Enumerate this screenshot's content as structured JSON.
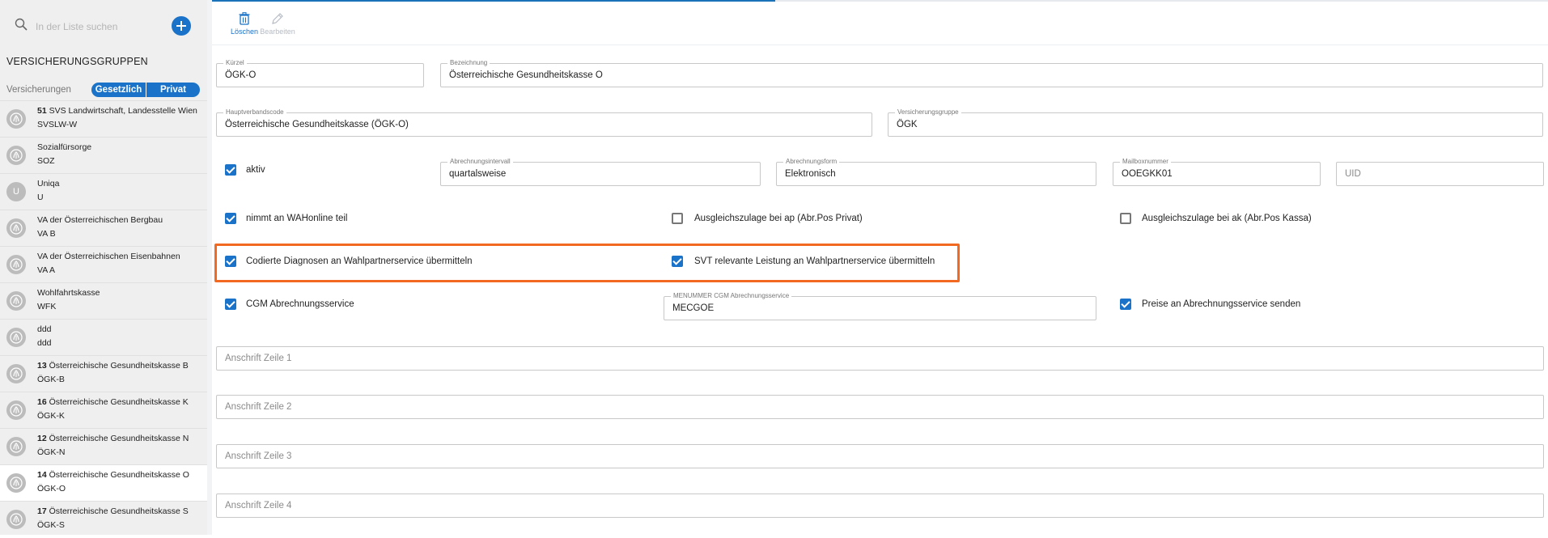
{
  "search": {
    "placeholder": "In der Liste suchen"
  },
  "sidebar": {
    "title": "VERSICHERUNGSGRUPPEN",
    "filter_label": "Versicherungen",
    "segments": [
      "Gesetzlich",
      "Privat"
    ],
    "items": [
      {
        "number": "51",
        "name": "SVS Landwirtschaft, Landesstelle Wien",
        "code": "SVSLW-W",
        "avatar": "logo-icon",
        "selected": false
      },
      {
        "number": "",
        "name": "Sozialfürsorge",
        "code": "SOZ",
        "avatar": "logo-icon",
        "selected": false
      },
      {
        "number": "",
        "name": "Uniqa",
        "code": "U",
        "avatar_letter": "U",
        "selected": false
      },
      {
        "number": "",
        "name": "VA der Österreichischen Bergbau",
        "code": "VA B",
        "avatar": "logo-icon",
        "selected": false
      },
      {
        "number": "",
        "name": "VA der Österreichischen Eisenbahnen",
        "code": "VA A",
        "avatar": "logo-icon",
        "selected": false
      },
      {
        "number": "",
        "name": "Wohlfahrtskasse",
        "code": "WFK",
        "avatar": "logo-icon",
        "selected": false
      },
      {
        "number": "",
        "name": "ddd",
        "code": "ddd",
        "avatar": "logo-icon",
        "selected": false
      },
      {
        "number": "13",
        "name": "Österreichische Gesundheitskasse B",
        "code": "ÖGK-B",
        "avatar": "logo-icon",
        "selected": false
      },
      {
        "number": "16",
        "name": "Österreichische Gesundheitskasse K",
        "code": "ÖGK-K",
        "avatar": "logo-icon",
        "selected": false
      },
      {
        "number": "12",
        "name": "Österreichische Gesundheitskasse N",
        "code": "ÖGK-N",
        "avatar": "logo-icon",
        "selected": false
      },
      {
        "number": "14",
        "name": "Österreichische Gesundheitskasse O",
        "code": "ÖGK-O",
        "avatar": "logo-icon",
        "selected": true
      },
      {
        "number": "17",
        "name": "Österreichische Gesundheitskasse S",
        "code": "ÖGK-S",
        "avatar": "logo-icon",
        "selected": false
      }
    ]
  },
  "toolbar": {
    "delete_label": "Löschen",
    "edit_label": "Bearbeiten"
  },
  "form": {
    "kuerzel": {
      "label": "Kürzel",
      "value": "ÖGK-O"
    },
    "bezeichnung": {
      "label": "Bezeichnung",
      "value": "Österreichische Gesundheitskasse O"
    },
    "hauptverbandscode": {
      "label": "Hauptverbandscode",
      "value": "Österreichische Gesundheitskasse (ÖGK-O)"
    },
    "versicherungsgruppe": {
      "label": "Versicherungsgruppe",
      "value": "ÖGK"
    },
    "aktiv": {
      "label": "aktiv",
      "checked": true
    },
    "abrechnungsintervall": {
      "label": "Abrechnungsintervall",
      "value": "quartalsweise"
    },
    "abrechnungsform": {
      "label": "Abrechnungsform",
      "value": "Elektronisch"
    },
    "mailboxnummer": {
      "label": "Mailboxnummer",
      "value": "OOEGKK01"
    },
    "uid": {
      "placeholder": "UID"
    },
    "wahonline": {
      "label": "nimmt an WAHonline teil",
      "checked": true
    },
    "ausgleich_ap": {
      "label": "Ausgleichszulage bei ap (Abr.Pos Privat)",
      "checked": false
    },
    "ausgleich_ak": {
      "label": "Ausgleichszulage bei ak (Abr.Pos Kassa)",
      "checked": false
    },
    "codierte_diagnosen": {
      "label": "Codierte Diagnosen an Wahlpartnerservice übermitteln",
      "checked": true
    },
    "svt_leistung": {
      "label": "SVT relevante Leistung an Wahlpartnerservice übermitteln",
      "checked": true
    },
    "cgm": {
      "label": "CGM Abrechnungsservice",
      "checked": true
    },
    "menummer": {
      "label": "MENUMMER CGM Abrechnungsservice",
      "value": "MECGOE"
    },
    "preise": {
      "label": "Preise an Abrechnungsservice senden",
      "checked": true
    },
    "anschrift1": {
      "placeholder": "Anschrift Zeile 1"
    },
    "anschrift2": {
      "placeholder": "Anschrift Zeile 2"
    },
    "anschrift3": {
      "placeholder": "Anschrift Zeile 3"
    },
    "anschrift4": {
      "placeholder": "Anschrift Zeile 4"
    }
  },
  "colors": {
    "accent": "#1a73c8",
    "highlight": "#f26a21"
  }
}
